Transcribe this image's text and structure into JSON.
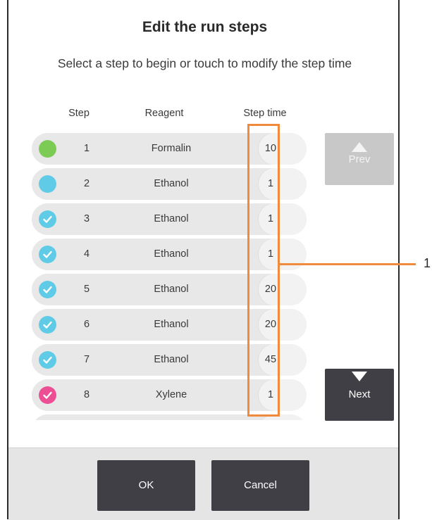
{
  "dialog": {
    "title": "Edit the run steps",
    "subtitle": "Select a step to begin or touch to modify the step time"
  },
  "columns": {
    "step": "Step",
    "reagent": "Reagent",
    "step_time": "Step time"
  },
  "steps": [
    {
      "step": "1",
      "reagent": "Formalin",
      "time": "10",
      "color": "#7ccb55",
      "checked": false
    },
    {
      "step": "2",
      "reagent": "Ethanol",
      "time": "1",
      "color": "#5fcbe6",
      "checked": false
    },
    {
      "step": "3",
      "reagent": "Ethanol",
      "time": "1",
      "color": "#5fcbe6",
      "checked": true
    },
    {
      "step": "4",
      "reagent": "Ethanol",
      "time": "1",
      "color": "#5fcbe6",
      "checked": true
    },
    {
      "step": "5",
      "reagent": "Ethanol",
      "time": "20",
      "color": "#5fcbe6",
      "checked": true
    },
    {
      "step": "6",
      "reagent": "Ethanol",
      "time": "20",
      "color": "#5fcbe6",
      "checked": true
    },
    {
      "step": "7",
      "reagent": "Ethanol",
      "time": "45",
      "color": "#5fcbe6",
      "checked": true
    },
    {
      "step": "8",
      "reagent": "Xylene",
      "time": "1",
      "color": "#ec4f94",
      "checked": true
    },
    {
      "step": "",
      "reagent": "",
      "time": "",
      "color": "#ec4f94",
      "checked": true
    }
  ],
  "nav": {
    "prev": "Prev",
    "next": "Next"
  },
  "footer": {
    "ok": "OK",
    "cancel": "Cancel"
  },
  "callout": {
    "label": "1",
    "color": "#f08a3c"
  }
}
